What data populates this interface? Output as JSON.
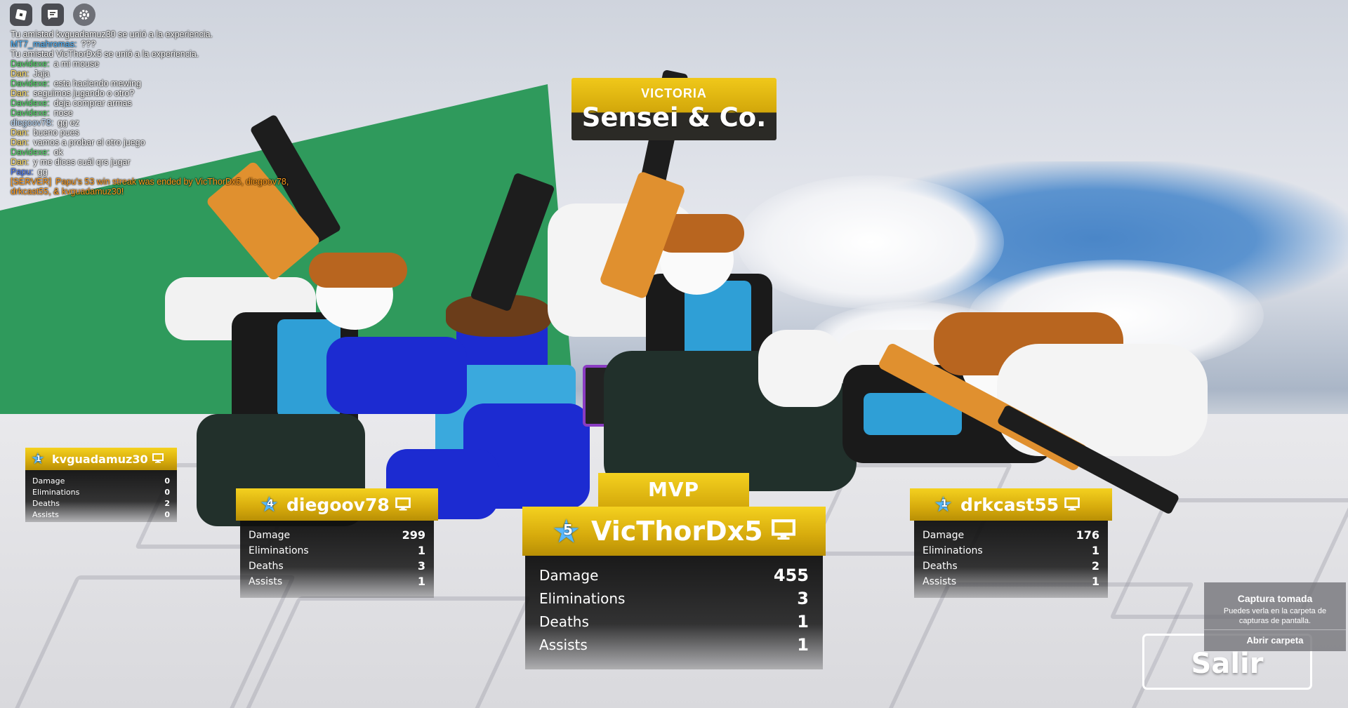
{
  "top_icons": [
    {
      "icon": "roblox-menu-icon"
    },
    {
      "icon": "chat-icon"
    },
    {
      "icon": "settings-gear-icon"
    }
  ],
  "chat": {
    "lines": [
      {
        "who": "",
        "text": "Tu amistad kvguadamuz30 se unió a la experiencia.",
        "color": "#ffffff"
      },
      {
        "who": "MT7_mahromas:",
        "text": "???",
        "color": "#4fb6ff"
      },
      {
        "who": "",
        "text": "Tu amistad VicThorDx5 se unió a la experiencia.",
        "color": "#ffffff"
      },
      {
        "who": "Davidexe:",
        "text": "a mi mouse",
        "color": "#55e26b"
      },
      {
        "who": "Dan:",
        "text": "Jaja",
        "color": "#ffe066"
      },
      {
        "who": "Davidexe:",
        "text": "esta haciendo mewing",
        "color": "#55e26b"
      },
      {
        "who": "Dan:",
        "text": "seguimos jugando o otro?",
        "color": "#ffe066"
      },
      {
        "who": "Davidexe:",
        "text": "deja comprar armas",
        "color": "#55e26b"
      },
      {
        "who": "Davidexe:",
        "text": "nose",
        "color": "#55e26b"
      },
      {
        "who": "diegoov78:",
        "text": "gg ez",
        "color": "#c0e0ff"
      },
      {
        "who": "Dan:",
        "text": "bueno pues",
        "color": "#ffe066"
      },
      {
        "who": "Dan:",
        "text": "vamos a probar el otro juego",
        "color": "#ffe066"
      },
      {
        "who": "Davidexe:",
        "text": "ok",
        "color": "#55e26b"
      },
      {
        "who": "Dan:",
        "text": "y me dices cuál qrs jugar",
        "color": "#ffe066"
      },
      {
        "who": "Papu:",
        "text": "gg",
        "color": "#4f7dff"
      },
      {
        "who": "[SERVER]",
        "text": "Papu's 53 win streak was ended by VicThorDx5, diegoov78,",
        "color": "#ff9b1a"
      },
      {
        "who": "",
        "text": "drkcast55, & kvguadamuz30!",
        "color": "#ff9b1a"
      }
    ]
  },
  "banner": {
    "subtitle": "VICTORIA",
    "team": "Sensei & Co."
  },
  "mvp_label": "MVP",
  "stat_labels": {
    "damage": "Damage",
    "eliminations": "Eliminations",
    "deaths": "Deaths",
    "assists": "Assists"
  },
  "players": {
    "mvp": {
      "name": "VicThorDx5",
      "level": "5",
      "damage": "455",
      "eliminations": "3",
      "deaths": "1",
      "assists": "1"
    },
    "left": {
      "name": "diegoov78",
      "level": "4",
      "damage": "299",
      "eliminations": "1",
      "deaths": "3",
      "assists": "1"
    },
    "right": {
      "name": "drkcast55",
      "level": "1",
      "damage": "176",
      "eliminations": "1",
      "deaths": "2",
      "assists": "1"
    },
    "far_left": {
      "name": "kvguadamuz30",
      "level": "1",
      "damage": "0",
      "eliminations": "0",
      "deaths": "2",
      "assists": "0"
    }
  },
  "notification": {
    "title": "Captura tomada",
    "description": "Puedes verla en la carpeta de capturas de pantalla.",
    "button": "Abrir carpeta"
  },
  "exit_button": "Salir",
  "colors": {
    "gold": "#d9ae0d",
    "panel": "#141414",
    "star": "#57b8ff",
    "wall": "#2f9a5c"
  }
}
